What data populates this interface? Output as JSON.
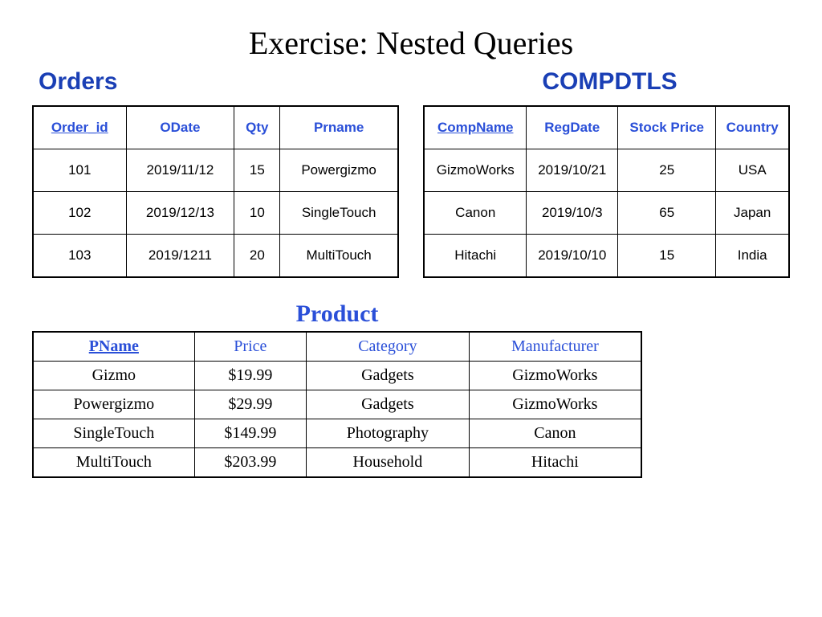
{
  "title": "Exercise: Nested Queries",
  "orders": {
    "title": "Orders",
    "headers": {
      "c0": "Order_id",
      "c1": "ODate",
      "c2": "Qty",
      "c3": "Prname"
    },
    "rows": [
      {
        "c0": "101",
        "c1": "2019/11/12",
        "c2": "15",
        "c3": "Powergizmo"
      },
      {
        "c0": "102",
        "c1": "2019/12/13",
        "c2": "10",
        "c3": "SingleTouch"
      },
      {
        "c0": "103",
        "c1": "2019/1211",
        "c2": "20",
        "c3": "MultiTouch"
      }
    ]
  },
  "compdtls": {
    "title": "COMPDTLS",
    "headers": {
      "c0": "CompName",
      "c1": "RegDate",
      "c2": "Stock Price",
      "c3": "Country"
    },
    "rows": [
      {
        "c0": "GizmoWorks",
        "c1": "2019/10/21",
        "c2": "25",
        "c3": "USA"
      },
      {
        "c0": "Canon",
        "c1": "2019/10/3",
        "c2": "65",
        "c3": "Japan"
      },
      {
        "c0": "Hitachi",
        "c1": "2019/10/10",
        "c2": "15",
        "c3": "India"
      }
    ]
  },
  "product": {
    "title": "Product",
    "headers": {
      "c0": "PName",
      "c1": "Price",
      "c2": "Category",
      "c3": "Manufacturer"
    },
    "rows": [
      {
        "c0": "Gizmo",
        "c1": "$19.99",
        "c2": "Gadgets",
        "c3": "GizmoWorks"
      },
      {
        "c0": "Powergizmo",
        "c1": "$29.99",
        "c2": "Gadgets",
        "c3": "GizmoWorks"
      },
      {
        "c0": "SingleTouch",
        "c1": "$149.99",
        "c2": "Photography",
        "c3": "Canon"
      },
      {
        "c0": "MultiTouch",
        "c1": "$203.99",
        "c2": "Household",
        "c3": "Hitachi"
      }
    ]
  }
}
